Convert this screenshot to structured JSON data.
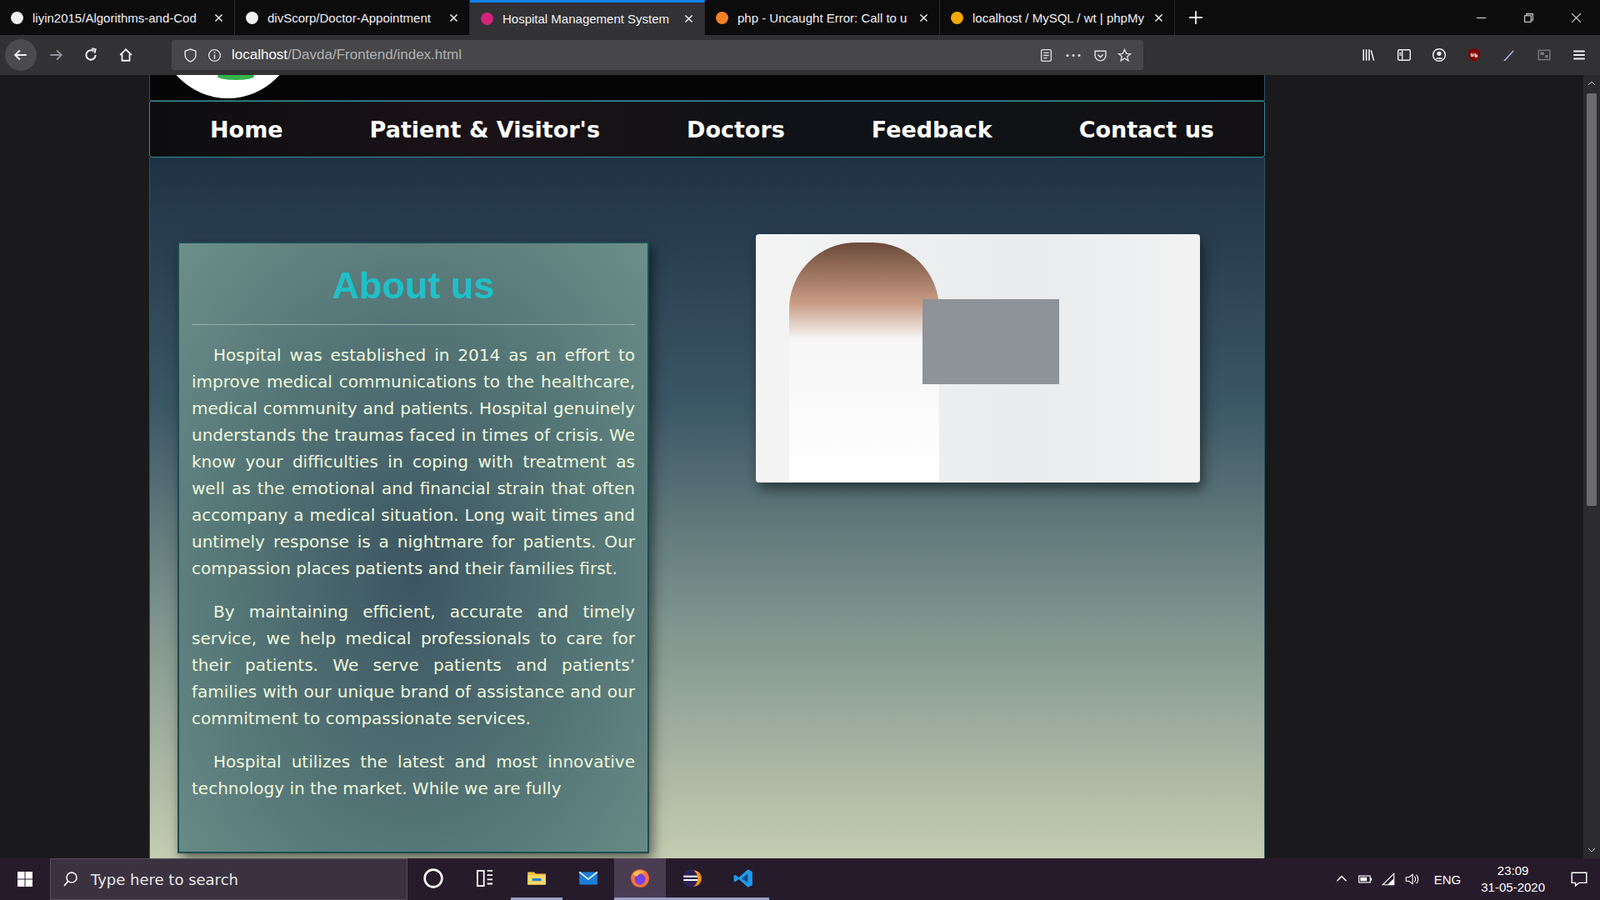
{
  "browser": {
    "tabs": [
      {
        "label": "liyin2015/Algorithms-and-Cod",
        "selected": false,
        "color": "#f0f0f0"
      },
      {
        "label": "divScorp/Doctor-Appointment",
        "selected": false,
        "color": "#f0f0f0"
      },
      {
        "label": "Hospital Management System",
        "selected": true,
        "color": "#d6247a"
      },
      {
        "label": "php - Uncaught Error: Call to u",
        "selected": false,
        "color": "#f48024"
      },
      {
        "label": "localhost / MySQL / wt | phpMy",
        "selected": false,
        "color": "#f2a900"
      }
    ],
    "url": {
      "host": "localhost",
      "path": "/Davda/Frontend/index.html"
    },
    "scrollbar": {
      "offset": 0.11,
      "level": 0.55
    }
  },
  "page": {
    "nav": [
      "Home",
      "Patient & Visitor's",
      "Doctors",
      "Feedback",
      "Contact us"
    ],
    "about": {
      "title": "About us",
      "paragraphs": [
        "Hospital was established in 2014 as an effort to improve medical communications to the healthcare, medical community and patients. Hospital genuinely understands the traumas faced in times of crisis. We know your difficulties in coping with treatment as well as the emotional and financial strain that often accompany a medical situation. Long wait times and untimely response is a nightmare for patients. Our compassion places patients and their families first.",
        "By maintaining efficient, accurate and timely service, we help medical professionals to care for their patients. We serve patients and patients’ families with our unique brand of assistance and our commitment to compassionate services.",
        "Hospital utilizes the latest and most innovative technology in the market. While we are fully"
      ]
    }
  },
  "taskbar": {
    "search_placeholder": "Type here to search",
    "apps": [
      {
        "kind": "explorer",
        "open": true,
        "focused": false
      },
      {
        "kind": "mail",
        "open": false,
        "focused": false
      },
      {
        "kind": "firefox",
        "open": true,
        "focused": true
      },
      {
        "kind": "eclipse",
        "open": true,
        "focused": false
      },
      {
        "kind": "vscode",
        "open": true,
        "focused": false
      }
    ],
    "language": "ENG",
    "time": "23:09",
    "date": "31-05-2020"
  }
}
